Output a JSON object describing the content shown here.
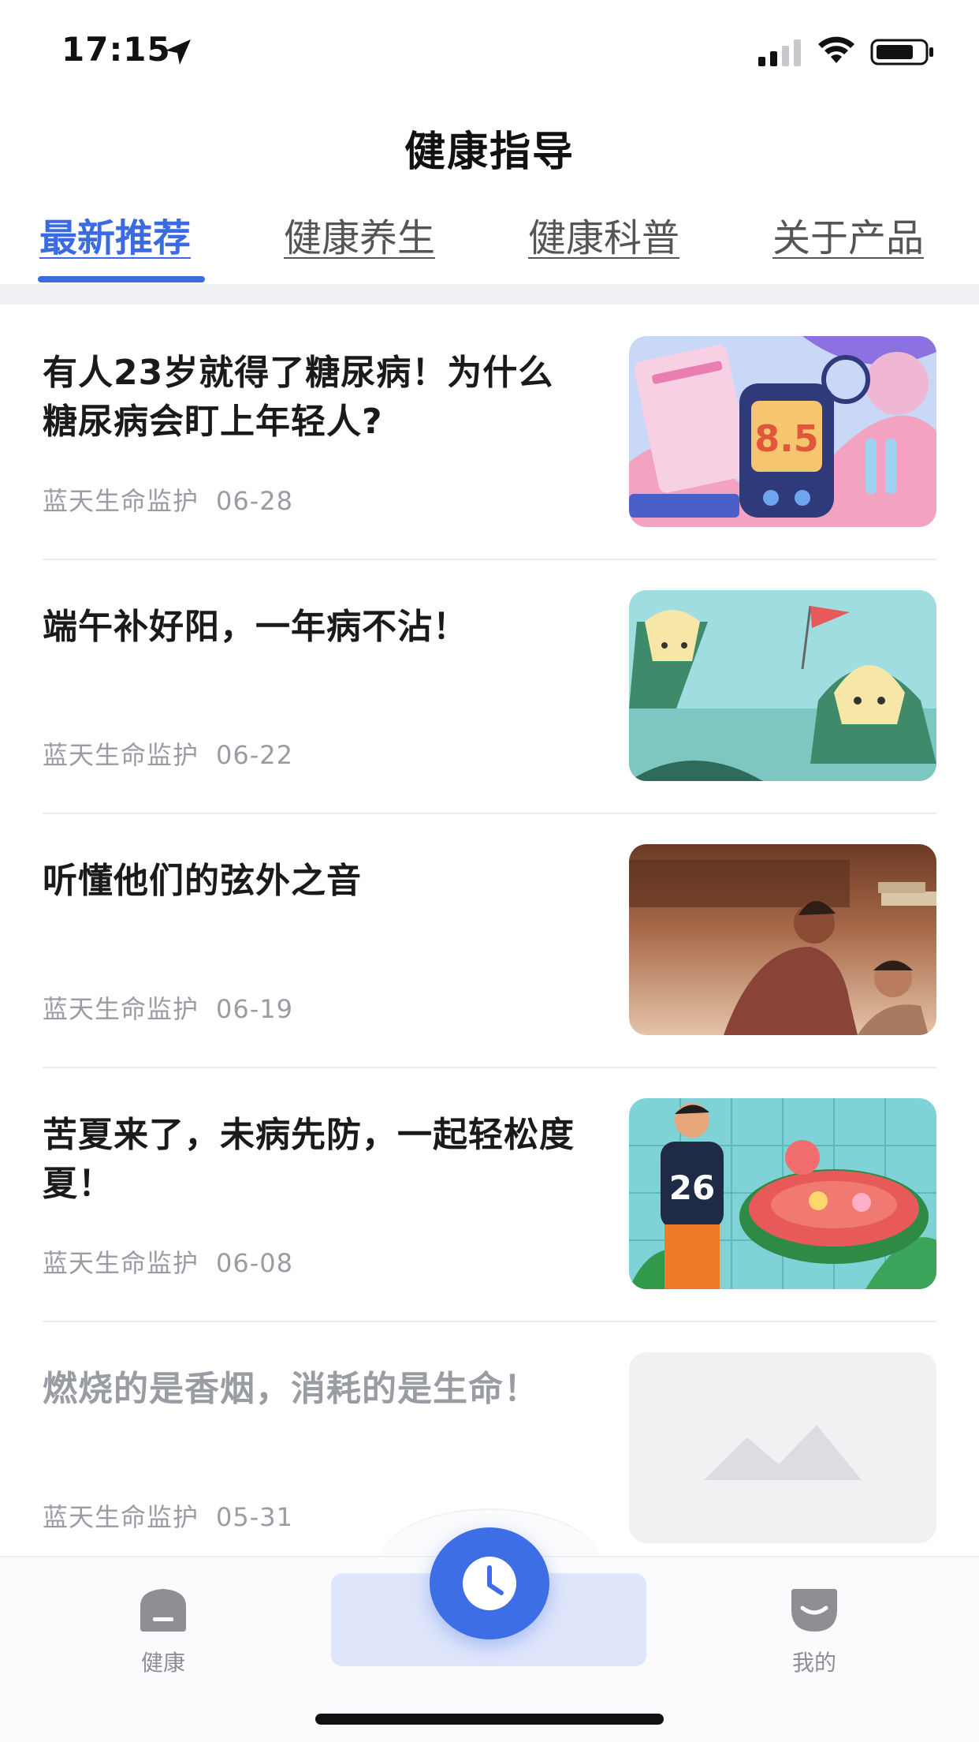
{
  "status_bar": {
    "time": "17:15"
  },
  "header": {
    "title": "健康指导"
  },
  "tabs": [
    {
      "label": "最新推荐",
      "active": true
    },
    {
      "label": "健康养生",
      "active": false
    },
    {
      "label": "健康科普",
      "active": false
    },
    {
      "label": "关于产品",
      "active": false
    }
  ],
  "articles": [
    {
      "title": "有人23岁就得了糖尿病！为什么糖尿病会盯上年轻人?",
      "source": "蓝天生命监护",
      "date": "06-28",
      "image": "diabetes-illustration",
      "glucose_reading": "8.5"
    },
    {
      "title": "端午补好阳，一年病不沾！",
      "source": "蓝天生命监护",
      "date": "06-22",
      "image": "zongzi-illustration"
    },
    {
      "title": "听懂他们的弦外之音",
      "source": "蓝天生命监护",
      "date": "06-19",
      "image": "parent-child-illustration"
    },
    {
      "title": "苦夏来了，未病先防，一起轻松度夏！",
      "source": "蓝天生命监护",
      "date": "06-08",
      "image": "summer-watermelon-illustration",
      "jersey_number": "26"
    },
    {
      "title": "燃烧的是香烟，消耗的是生命！",
      "source": "蓝天生命监护",
      "date": "05-31",
      "image": "image-placeholder"
    }
  ],
  "tab_bar": {
    "health_label": "健康",
    "center_icon": "clock-icon",
    "mine_label": "我的"
  },
  "colors": {
    "accent": "#3b6be0",
    "meta_text": "#9a9ca3",
    "tab_center_bg": "#dfe6fb"
  }
}
